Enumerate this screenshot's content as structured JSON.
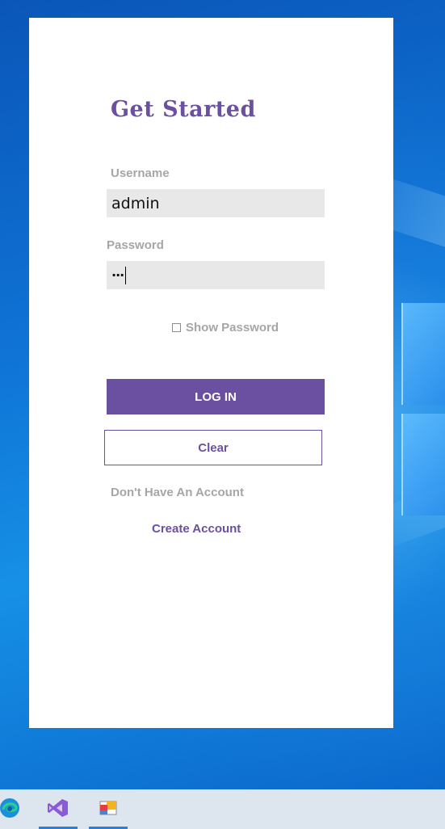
{
  "login": {
    "title": "Get Started",
    "username_label": "Username",
    "username_value": "admin",
    "password_label": "Password",
    "password_value": "···",
    "show_password_label": "Show Password",
    "show_password_checked": false,
    "login_button": "LOG IN",
    "clear_button": "Clear",
    "no_account_text": "Don't Have An Account",
    "create_account_link": "Create Account"
  },
  "taskbar": {
    "items": [
      {
        "icon": "edge-icon",
        "active": false
      },
      {
        "icon": "visual-studio-icon",
        "active": true
      },
      {
        "icon": "app-window-icon",
        "active": true
      }
    ]
  },
  "colors": {
    "accent": "#6b4fa0",
    "muted_label": "#a6a6a6",
    "field_bg": "#e8e8e8"
  }
}
